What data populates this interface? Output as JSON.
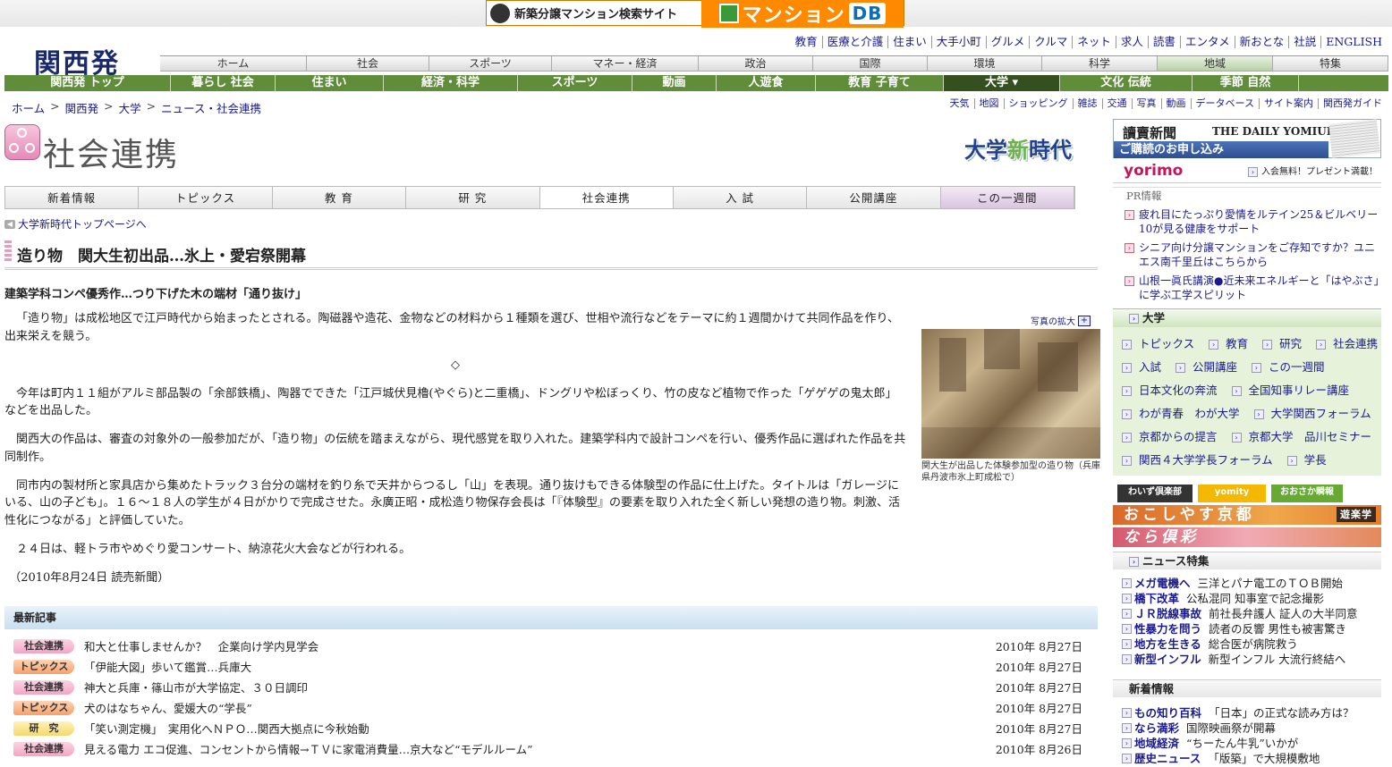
{
  "banner": {
    "left_text": "新築分譲マンション検索サイト",
    "right_text": "マンション",
    "right_db": "DB"
  },
  "logo": "関西発",
  "top_links": [
    "教育",
    "医療と介護",
    "住まい",
    "大手小町",
    "グルメ",
    "クルマ",
    "ネット",
    "求人",
    "読書",
    "エンタメ",
    "新おとな",
    "社説",
    "ENGLISH"
  ],
  "gray_tabs": [
    "ホーム",
    "社会",
    "スポーツ",
    "マネー・経済",
    "政治",
    "国際",
    "環境",
    "科学",
    "地域",
    "特集"
  ],
  "green_nav": [
    "関西発 トップ",
    "暮らし 社会",
    "住まい",
    "経済・科学",
    "スポーツ",
    "動画",
    "人遊食",
    "教育 子育て",
    "大学 ▾",
    "文化 伝統",
    "季節 自然"
  ],
  "breadcrumb": [
    "ホーム",
    "関西発",
    "大学",
    "ニュース・社会連携"
  ],
  "util_links": [
    "天気",
    "地図",
    "ショッピング",
    "雑誌",
    "交通",
    "写真",
    "動画",
    "データベース",
    "サイト案内",
    "関西発ガイド"
  ],
  "section_title": "社会連携",
  "univ_logo": {
    "a": "大学",
    "b": "新",
    "c": "時代"
  },
  "section_tabs": [
    "新着情報",
    "トピックス",
    "教 育",
    "研 究",
    "社会連携",
    "入 試",
    "公開講座",
    "この一週間"
  ],
  "back_link": "大学新時代トップページへ",
  "article": {
    "headline": "造り物　関大生初出品…氷上・愛宕祭開幕",
    "subhead": "建築学科コンペ優秀作…つり下げた木の端材「通り抜け」",
    "paragraphs": [
      "「造り物」は成松地区で江戸時代から始まったとされる。陶磁器や造花、金物などの材料から１種類を選び、世相や流行などをテーマに約１週間かけて共同作品を作り、出来栄えを競う。",
      "◇",
      "今年は町内１１組がアルミ部品製の「余部鉄橋」、陶器でできた「江戸城伏見櫓(やぐら)と二重橋」、ドングリや松ぼっくり、竹の皮など植物で作った「ゲゲゲの鬼太郎」などを出品した。",
      "関西大の作品は、審査の対象外の一般参加だが、「造り物」の伝統を踏まえながら、現代感覚を取り入れた。建築学科内で設計コンペを行い、優秀作品に選ばれた作品を共同制作。",
      "同市内の製材所と家具店から集めたトラック３台分の端材を釣り糸で天井からつるし「山」を表現。通り抜けもできる体験型の作品に仕上げた。タイトルは「ガレージにいる、山の子ども」。１６～１８人の学生が４日がかりで完成させた。永廣正昭・成松造り物保存会長は「『体験型』の要素を取り入れた全く新しい発想の造り物。刺激、活性化につながる」と評価していた。",
      "２４日は、軽トラ市やめぐり愛コンサート、納涼花火大会などが行われる。",
      "（2010年8月24日  読売新聞）"
    ],
    "photo_zoom": "写真の拡大",
    "photo_caption": "関大生が出品した体験参加型の造り物（兵庫県丹波市氷上町成松で）"
  },
  "latest": {
    "header": "最新記事",
    "rows": [
      {
        "badge": "社会連携",
        "color": "pink",
        "title": "和大と仕事しませんか？　企業向け学内見学会",
        "date": "2010年  8月27日"
      },
      {
        "badge": "トピックス",
        "color": "orange",
        "title": "「伊能大図」歩いて鑑賞…兵庫大",
        "date": "2010年  8月27日"
      },
      {
        "badge": "社会連携",
        "color": "pink",
        "title": "神大と兵庫・篠山市が大学協定、３０日調印",
        "date": "2010年  8月27日"
      },
      {
        "badge": "トピックス",
        "color": "orange",
        "title": "犬のはなちゃん、愛媛大の“学長”",
        "date": "2010年  8月27日"
      },
      {
        "badge": "研　究",
        "color": "yellow",
        "title": "「笑い測定機」　実用化へＮＰＯ…関西大拠点に今秋始動",
        "date": "2010年  8月27日"
      },
      {
        "badge": "社会連携",
        "color": "pink",
        "title": "見える電力 エコ促進、コンセントから情報→ＴＶに家電消費量…京大など“モデルルーム”",
        "date": "2010年  8月26日"
      }
    ]
  },
  "sidebar": {
    "yomiuri": {
      "name": "讀賣新聞",
      "en": "THE DAILY YOMIURI",
      "bar": "ご購読のお申し込み"
    },
    "yorimo": {
      "logo": "yorimo",
      "text": "入会無料！プレゼント満載！"
    },
    "pr": {
      "header": "PR情報",
      "items": [
        "疲れ目にたっぷり愛情をルテイン25＆ビルベリー10が見る健康をサポート",
        "シニア向け分譲マンションをご存知ですか？ユニエス南千里丘はこちらから",
        "山根一眞氏講演●近未来エネルギーと「はやぶさ」に学ぶ工学スピリット"
      ]
    },
    "univ": {
      "header": "大学",
      "rows": [
        [
          "トピックス",
          "教育",
          "研究",
          "社会連携"
        ],
        [
          "入試",
          "公開講座",
          "この一週間"
        ],
        [
          "日本文化の奔流",
          "全国知事リレー講座"
        ],
        [
          "わが青春　わが大学",
          "大学関西フォーラム"
        ],
        [
          "京都からの提言",
          "京都大学　品川セミナー"
        ],
        [
          "関西４大学学長フォーラム",
          "学長"
        ]
      ]
    },
    "small_ads": [
      "わいず倶楽部",
      "yomity",
      "おおさか瞬報"
    ],
    "okoshi": {
      "text": "おこしやす京都",
      "tag": "遊楽学"
    },
    "nara": "なら倶彩",
    "news_feature": {
      "header": "ニュース特集",
      "items": [
        {
          "k": "メガ電機へ",
          "t": "三洋とパナ電工のＴＯＢ開始"
        },
        {
          "k": "橋下改革",
          "t": "公私混同 知事室で記念撮影"
        },
        {
          "k": "ＪＲ脱線事故",
          "t": "前社長弁護人 証人の大半同意"
        },
        {
          "k": "性暴力を問う",
          "t": "読者の反響 男性も被害驚き"
        },
        {
          "k": "地方を生きる",
          "t": "総合医が病院救う"
        },
        {
          "k": "新型インフル",
          "t": "新型インフル 大流行終結へ"
        }
      ]
    },
    "newest": {
      "header": "新着情報",
      "items": [
        {
          "k": "もの知り百科",
          "t": "「日本」の正式な読み方は？"
        },
        {
          "k": "なら満彩",
          "t": "国際映画祭が開幕"
        },
        {
          "k": "地域経済",
          "t": "“ちーたん牛乳”いかが"
        },
        {
          "k": "歴史ニュース",
          "t": "「版築」で大規模敷地"
        }
      ]
    }
  }
}
